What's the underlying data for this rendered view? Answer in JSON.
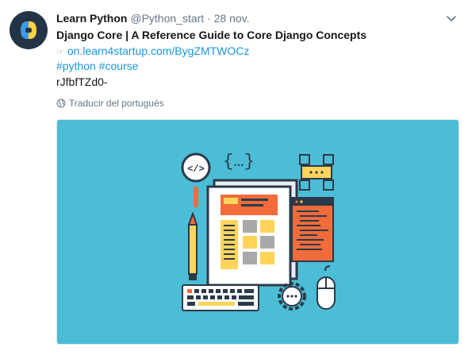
{
  "tweet": {
    "author_name": "Learn Python",
    "handle": "@Python_start",
    "separator": "·",
    "date": "28 nov.",
    "title": "Django Core | A Reference Guide to Core Django Concepts",
    "link_pointer": "☞",
    "link": "on.learn4startup.com/BygZMTWOCz",
    "hashtags": [
      "#python",
      "#course"
    ],
    "code": "rJfbfTZd0-",
    "translate_label": "Traducir del portugués",
    "avatar_icon": "python-logo-icon",
    "caret_icon": "chevron-down-icon",
    "globe_icon": "globe-icon",
    "media_icon": "web-development-illustration",
    "colors": {
      "media_bg": "#4cbdd6",
      "accent_link": "#1b95e0",
      "avatar_bg": "#233446",
      "orange": "#f26b3a",
      "yellow": "#ffd45a"
    }
  }
}
